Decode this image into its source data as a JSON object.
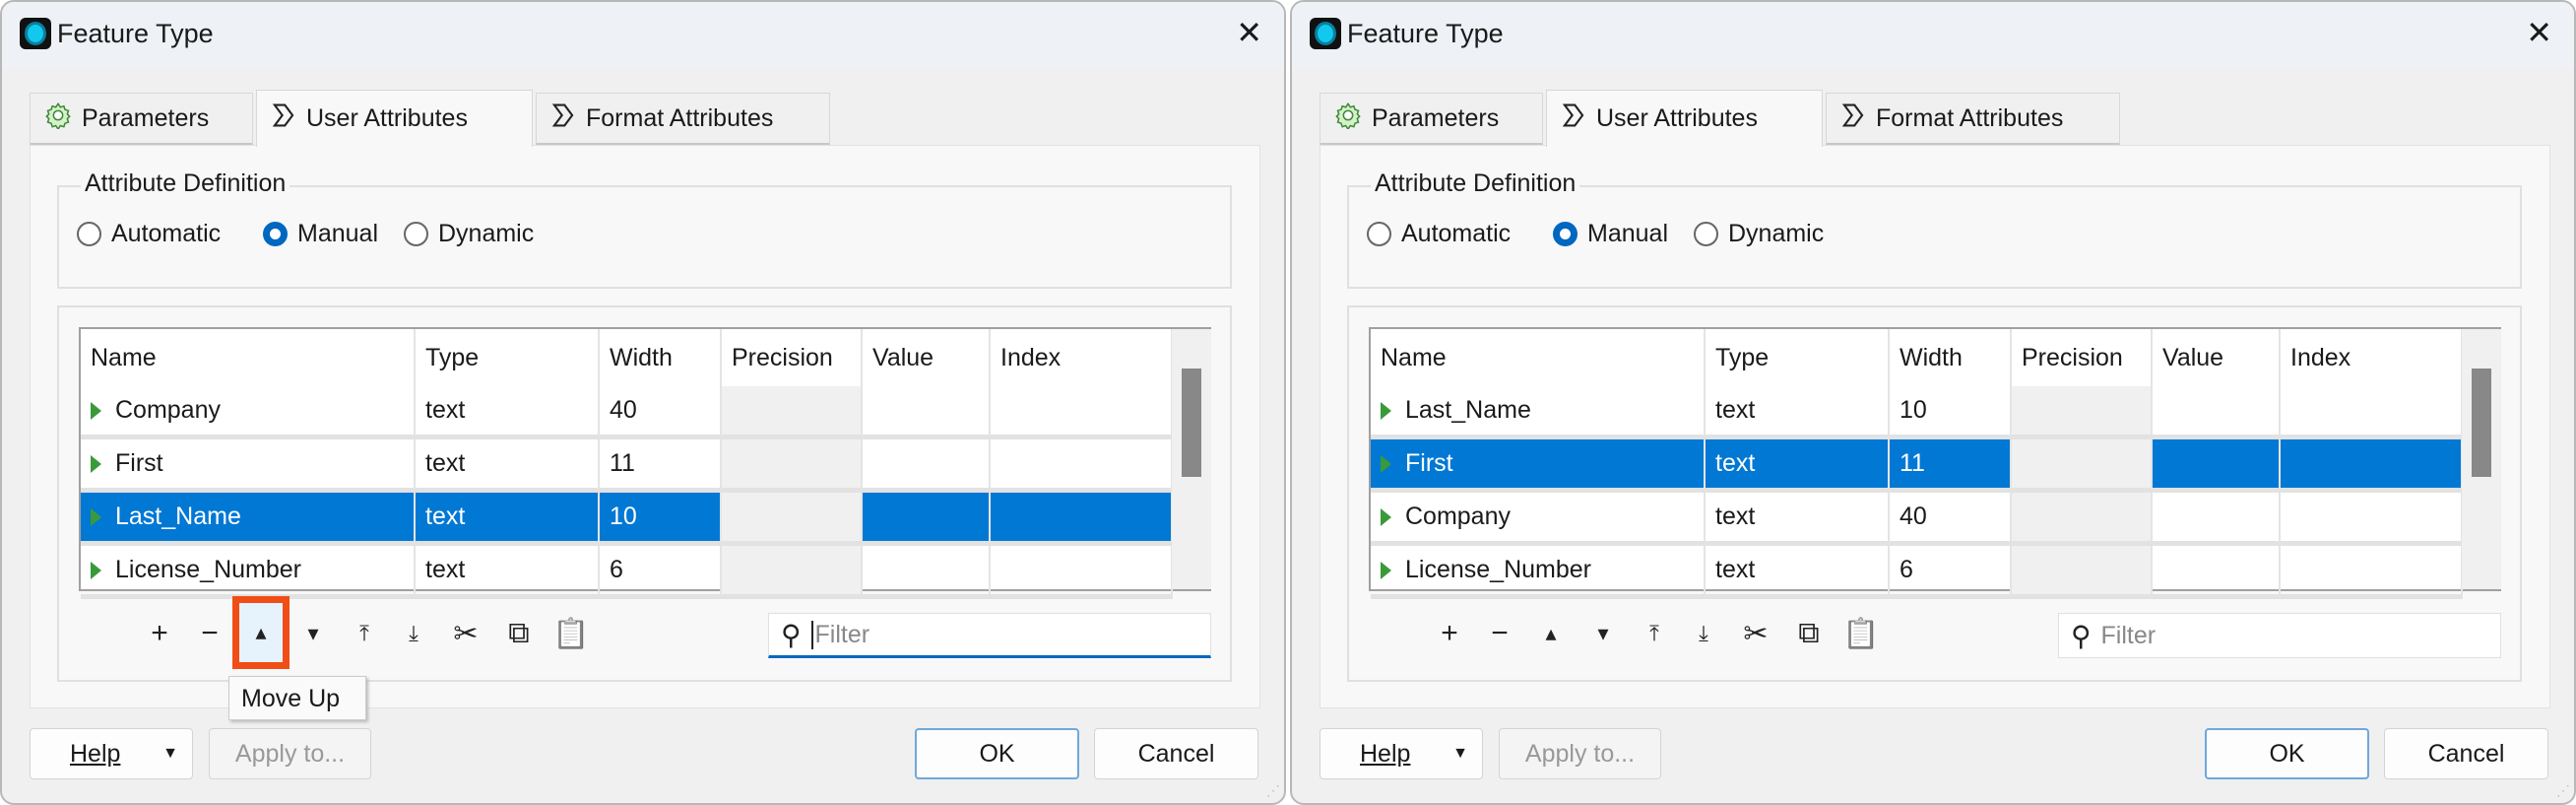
{
  "dialogs": [
    {
      "title": "Feature Type",
      "tabs": [
        "Parameters",
        "User Attributes",
        "Format Attributes"
      ],
      "group_label": "Attribute Definition",
      "radios": [
        {
          "label": "Automatic",
          "checked": false
        },
        {
          "label": "Manual",
          "checked": true
        },
        {
          "label": "Dynamic",
          "checked": false
        }
      ],
      "columns": [
        "Name",
        "Type",
        "Width",
        "Precision",
        "Value",
        "Index"
      ],
      "rows": [
        {
          "name": "Company",
          "type": "text",
          "width": "40",
          "selected": false
        },
        {
          "name": "First",
          "type": "text",
          "width": "11",
          "selected": false
        },
        {
          "name": "Last_Name",
          "type": "text",
          "width": "10",
          "selected": true
        },
        {
          "name": "License_Number",
          "type": "text",
          "width": "6",
          "selected": false
        }
      ],
      "filter_placeholder": "Filter",
      "filter_focused": true,
      "move_up_highlighted": true,
      "tooltip": "Move Up",
      "buttons": {
        "help": "Help",
        "apply": "Apply to...",
        "ok": "OK",
        "cancel": "Cancel"
      }
    },
    {
      "title": "Feature Type",
      "tabs": [
        "Parameters",
        "User Attributes",
        "Format Attributes"
      ],
      "group_label": "Attribute Definition",
      "radios": [
        {
          "label": "Automatic",
          "checked": false
        },
        {
          "label": "Manual",
          "checked": true
        },
        {
          "label": "Dynamic",
          "checked": false
        }
      ],
      "columns": [
        "Name",
        "Type",
        "Width",
        "Precision",
        "Value",
        "Index"
      ],
      "rows": [
        {
          "name": "Last_Name",
          "type": "text",
          "width": "10",
          "selected": false
        },
        {
          "name": "First",
          "type": "text",
          "width": "11",
          "selected": true
        },
        {
          "name": "Company",
          "type": "text",
          "width": "40",
          "selected": false
        },
        {
          "name": "License_Number",
          "type": "text",
          "width": "6",
          "selected": false
        }
      ],
      "filter_placeholder": "Filter",
      "filter_focused": false,
      "move_up_highlighted": false,
      "tooltip": null,
      "buttons": {
        "help": "Help",
        "apply": "Apply to...",
        "ok": "OK",
        "cancel": "Cancel"
      }
    }
  ],
  "colors": {
    "selection": "#0078d4",
    "highlight": "#f04e16",
    "accent": "#0067c0"
  }
}
